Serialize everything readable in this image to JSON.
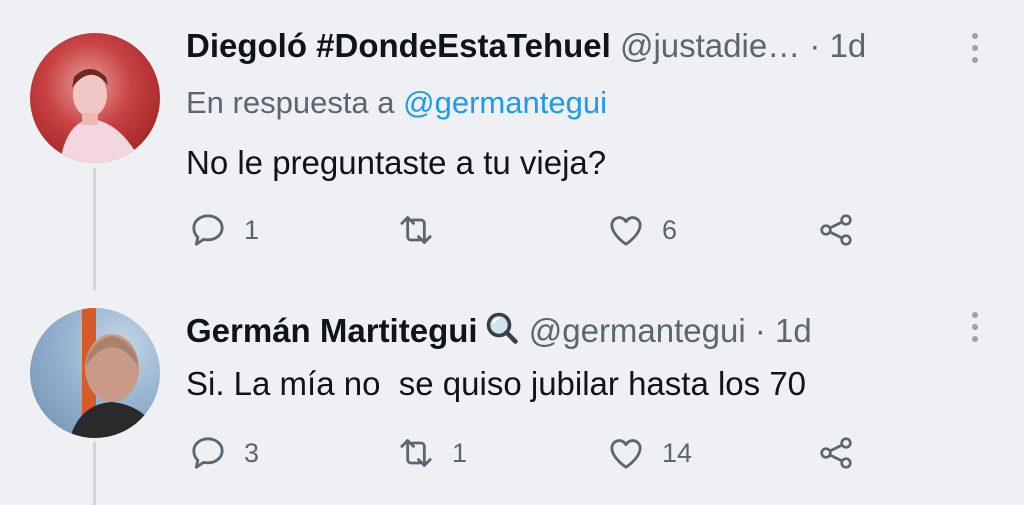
{
  "tweets": [
    {
      "name": "Diegoló #DondeEstaTehuel",
      "handle": "@justadie…",
      "time": "1d",
      "reply_prefix": "En respuesta a",
      "reply_mention": "@germantegui",
      "text": "No le preguntaste a tu vieja?",
      "replies": "1",
      "retweets": "",
      "likes": "6"
    },
    {
      "name": "Germán Martitegui",
      "name_emoji": "magnifying-glass-icon",
      "handle": "@germantegui",
      "time": "1d",
      "text": "Si. La mía no  se quiso jubilar hasta los 70",
      "replies": "3",
      "retweets": "1",
      "likes": "14"
    }
  ],
  "separator": "·",
  "colors": {
    "background": "#eef0f3",
    "link": "#1d9bf0",
    "muted": "#5b6670",
    "text": "#0f1419"
  }
}
